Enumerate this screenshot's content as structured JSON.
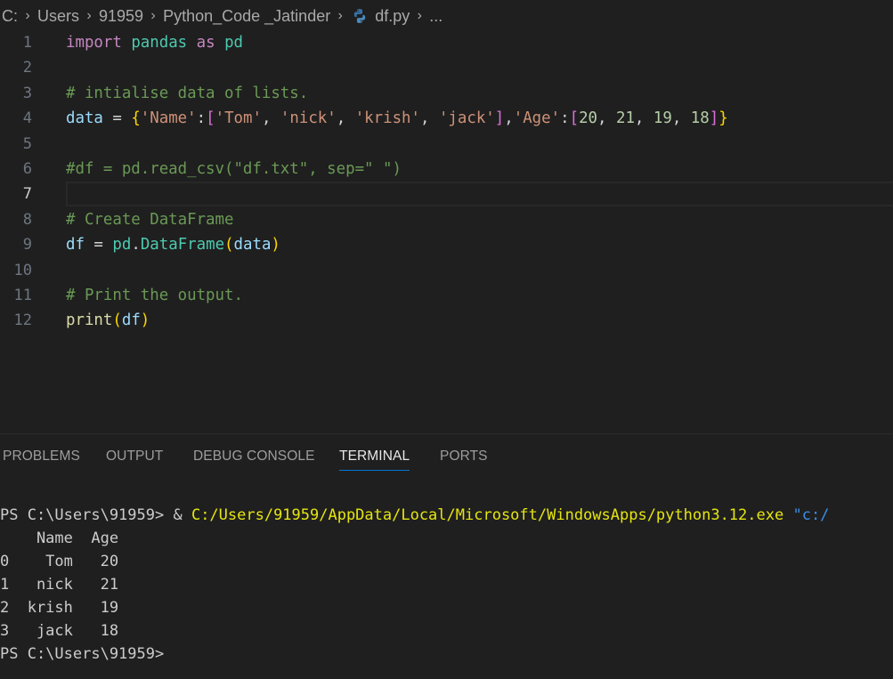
{
  "breadcrumb": {
    "items": [
      "C:",
      "Users",
      "91959",
      "Python_Code _Jatinder",
      "df.py",
      "..."
    ],
    "file_icon": "python-icon"
  },
  "editor": {
    "lines": [
      {
        "number": "1"
      },
      {
        "number": "2"
      },
      {
        "number": "3",
        "text": "# intialise data of lists."
      },
      {
        "number": "4"
      },
      {
        "number": "5"
      },
      {
        "number": "6",
        "text": "#df = pd.read_csv(\"df.txt\", sep=\" \")"
      },
      {
        "number": "7"
      },
      {
        "number": "8",
        "text": "# Create DataFrame"
      },
      {
        "number": "9"
      },
      {
        "number": "10"
      },
      {
        "number": "11",
        "text": "# Print the output."
      },
      {
        "number": "12"
      }
    ],
    "tokens": {
      "import": "import",
      "pandas": "pandas",
      "as": "as",
      "pd": "pd",
      "data": "data",
      "eq": " = ",
      "name_key": "'Name'",
      "names": [
        "'Tom'",
        "'nick'",
        "'krish'",
        "'jack'"
      ],
      "age_key": "'Age'",
      "ages": [
        "20",
        "21",
        "19",
        "18"
      ],
      "df": "df",
      "DataFrame": "DataFrame",
      "print": "print"
    },
    "active_line": 7
  },
  "panel": {
    "tabs": [
      "PROBLEMS",
      "OUTPUT",
      "DEBUG CONSOLE",
      "TERMINAL",
      "PORTS"
    ],
    "active_tab": "TERMINAL"
  },
  "terminal": {
    "prompt": "PS C:\\Users\\91959> ",
    "command_amp": "& ",
    "command_path": "C:/Users/91959/AppData/Local/Microsoft/WindowsApps/python3.12.exe",
    "command_arg": " \"c:/",
    "output": [
      "    Name  Age",
      "0    Tom   20",
      "1   nick   21",
      "2  krish   19",
      "3   jack   18"
    ],
    "final_prompt": "PS C:\\Users\\91959>"
  },
  "colors": {
    "background": "#1f1f1f",
    "keyword": "#c586c0",
    "module": "#4ec9b0",
    "variable": "#9cdcfe",
    "string": "#ce9178",
    "number": "#b5cea8",
    "comment": "#6a9955",
    "function": "#dcdcaa",
    "active_tab_underline": "#0078d4"
  }
}
